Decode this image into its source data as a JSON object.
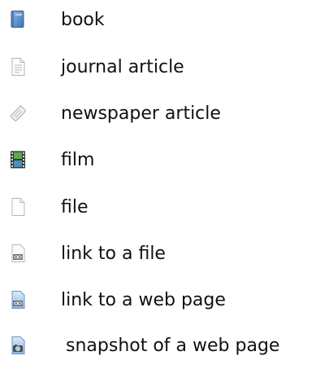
{
  "legend": {
    "items": [
      {
        "icon": "book-icon",
        "label": "book"
      },
      {
        "icon": "journal-article-icon",
        "label": "journal article"
      },
      {
        "icon": "newspaper-article-icon",
        "label": "newspaper article"
      },
      {
        "icon": "film-icon",
        "label": "film"
      },
      {
        "icon": "file-icon",
        "label": "file"
      },
      {
        "icon": "linked-file-icon",
        "label": "link to a file"
      },
      {
        "icon": "linked-web-page-icon",
        "label": "link to a web page"
      },
      {
        "icon": "web-snapshot-icon",
        "label": "snapshot of a web page"
      }
    ],
    "colors": {
      "book": "#5b8fc9",
      "paper_border": "#b7b7b7",
      "film": "#3e8a3a",
      "link_badge": "#6f6f6f"
    }
  }
}
